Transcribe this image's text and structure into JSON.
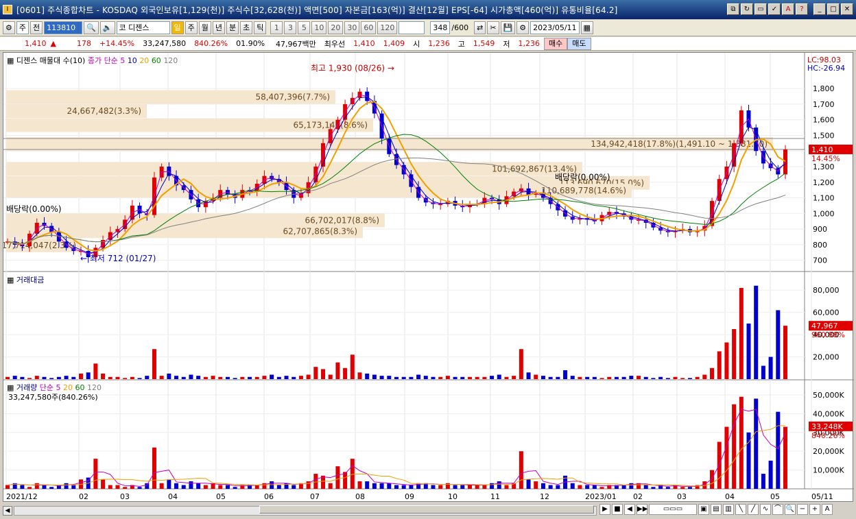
{
  "window": {
    "title": "[0601] 주식종합차트 - KOSDAQ 외국인보유[1,129(천)] 주식수[32,628(천)] 액면[500] 자본금[163(억)] 결산[12월] EPS[-64] 시가총액[460(억)] 유통비율[64.2]",
    "app_icon": "I"
  },
  "toolbar": {
    "period_type": "주",
    "mode": "전",
    "code": "113810",
    "name": "코 디젠스",
    "periods": [
      "일",
      "주",
      "월",
      "년",
      "분",
      "초",
      "틱"
    ],
    "active_period": "일",
    "intervals": [
      "1",
      "3",
      "5",
      "10",
      "20",
      "30",
      "60",
      "120"
    ],
    "count": "348",
    "count_total": "/600",
    "date": "2023/05/11"
  },
  "pricebar": {
    "price": "1,410",
    "change": "178",
    "change_pct": "+14.45%",
    "volume": "33,247,580",
    "vol_ratio": "840.26%",
    "turnover_pct": "01.90%",
    "amount": "47,967백만",
    "best_bid_label": "최우선",
    "bid1": "1,410",
    "bid2": "1,409",
    "open_label": "시",
    "open": "1,236",
    "high_label": "고",
    "high": "1,549",
    "low_label": "저",
    "low": "1,236",
    "buy": "매수",
    "sell": "매도"
  },
  "price_pane": {
    "title": "디젠스 매물대 수(10)",
    "ma_legend": {
      "label": "종가 단순",
      "periods": [
        "5",
        "10",
        "20",
        "60",
        "120"
      ]
    },
    "lc": "LC:98.03",
    "hc": "HC:-26.94",
    "current_price": "1,410",
    "current_pct": "14.45%",
    "yticks": [
      "1,800",
      "1,700",
      "1,600",
      "1,500",
      "1,400",
      "1,300",
      "1,200",
      "1,100",
      "1,000",
      "900",
      "800",
      "700"
    ],
    "volume_profile": [
      "58,407,396(7.7%)",
      "24,667,482(3.3%)",
      "65,173,143(8.6%)",
      "134,942,418(17.8%)(1,491.10 ~ 1,381.60)",
      "101,692,867(13.4%)",
      "113,690,670(15.0%)",
      "110,689,778(14.6%)",
      "66,702,017(8.8%)",
      "62,707,865(8.3%)",
      "17,714,047(2.3%)"
    ],
    "annotations": {
      "high": "최고 1,930 (08/26)",
      "low": "최저 712 (01/27)",
      "div1": "배당락(0.00%)",
      "div2": "배당락(0.00%)"
    }
  },
  "amount_pane": {
    "title": "거래대금",
    "yticks": [
      "80,000",
      "60,000",
      "40,000",
      "20,000"
    ],
    "current": "47,967",
    "current_pct": "960.88%"
  },
  "volume_pane": {
    "title": "거래량",
    "ma_legend": {
      "label": "단순",
      "periods": [
        "5",
        "20",
        "60",
        "120"
      ]
    },
    "value_text": "33,247,580주(840.26%)",
    "yticks": [
      "50,000K",
      "40,000K",
      "30,000K",
      "20,000K",
      "10,000K"
    ],
    "current": "33,248K",
    "current_pct": "840.26%"
  },
  "xaxis": [
    "2021/12",
    "02",
    "03",
    "04",
    "05",
    "06",
    "07",
    "08",
    "09",
    "10",
    "11",
    "12",
    "2023/01",
    "02",
    "03",
    "04",
    "05",
    "05/11"
  ],
  "colors": {
    "up": "#e00000",
    "down": "#0000d0",
    "ma5": "#c000c0",
    "ma10": "#0000c0",
    "ma20": "#f0a000",
    "ma60": "#008000",
    "ma120": "#808080",
    "profile": "#f5e6d0"
  },
  "chart_data": {
    "type": "candlestick",
    "ylim": [
      650,
      1950
    ],
    "series_sampled_close": [
      820,
      800,
      790,
      870,
      940,
      920,
      880,
      820,
      780,
      760,
      760,
      720,
      780,
      830,
      880,
      900,
      960,
      1050,
      1000,
      990,
      1230,
      1300,
      1240,
      1180,
      1150,
      1090,
      1040,
      1080,
      1100,
      1150,
      1120,
      1100,
      1150,
      1140,
      1190,
      1240,
      1220,
      1200,
      1150,
      1100,
      1130,
      1200,
      1300,
      1450,
      1540,
      1600,
      1700,
      1740,
      1780,
      1720,
      1640,
      1480,
      1380,
      1310,
      1250,
      1170,
      1100,
      1070,
      1060,
      1060,
      1080,
      1050,
      1040,
      1060,
      1060,
      1100,
      1090,
      1060,
      1110,
      1140,
      1160,
      1120,
      1130,
      1100,
      1060,
      1020,
      980,
      960,
      970,
      960,
      950,
      990,
      1010,
      1000,
      980,
      960,
      960,
      940,
      910,
      890,
      880,
      890,
      900,
      880,
      890,
      920,
      1080,
      1220,
      1300,
      1450,
      1660,
      1550,
      1400,
      1320,
      1290,
      1250,
      1410
    ],
    "amount_series": [
      2,
      3,
      2,
      1,
      3,
      2,
      1,
      2,
      3,
      2,
      5,
      6,
      14,
      5,
      2,
      2,
      1,
      2,
      1,
      3,
      27,
      3,
      5,
      3,
      2,
      4,
      3,
      2,
      3,
      2,
      2,
      1,
      2,
      2,
      2,
      3,
      4,
      2,
      3,
      2,
      3,
      4,
      11,
      9,
      4,
      15,
      10,
      22,
      6,
      5,
      4,
      3,
      3,
      2,
      2,
      2,
      4,
      3,
      2,
      2,
      3,
      2,
      2,
      2,
      2,
      2,
      3,
      4,
      2,
      3,
      27,
      6,
      4,
      3,
      2,
      2,
      8,
      3,
      2,
      2,
      2,
      1,
      2,
      2,
      2,
      3,
      3,
      2,
      1,
      2,
      1,
      2,
      1,
      1,
      2,
      4,
      10,
      25,
      33,
      45,
      82,
      50,
      84,
      12,
      20,
      62,
      48
    ],
    "volume_series": [
      2,
      3,
      2,
      1,
      3,
      2,
      1,
      2,
      3,
      2,
      5,
      6,
      16,
      5,
      2,
      2,
      1,
      2,
      1,
      3,
      22,
      3,
      5,
      3,
      2,
      4,
      3,
      2,
      3,
      2,
      2,
      1,
      2,
      2,
      2,
      3,
      4,
      2,
      3,
      2,
      3,
      4,
      8,
      7,
      3,
      12,
      9,
      16,
      4,
      4,
      3,
      3,
      3,
      2,
      2,
      2,
      3,
      3,
      2,
      2,
      3,
      2,
      2,
      2,
      2,
      2,
      3,
      4,
      2,
      3,
      20,
      5,
      4,
      3,
      2,
      2,
      7,
      3,
      2,
      2,
      2,
      1,
      2,
      2,
      2,
      3,
      3,
      2,
      1,
      2,
      1,
      2,
      1,
      1,
      2,
      4,
      10,
      25,
      33,
      45,
      49,
      30,
      48,
      8,
      15,
      41,
      33
    ]
  }
}
